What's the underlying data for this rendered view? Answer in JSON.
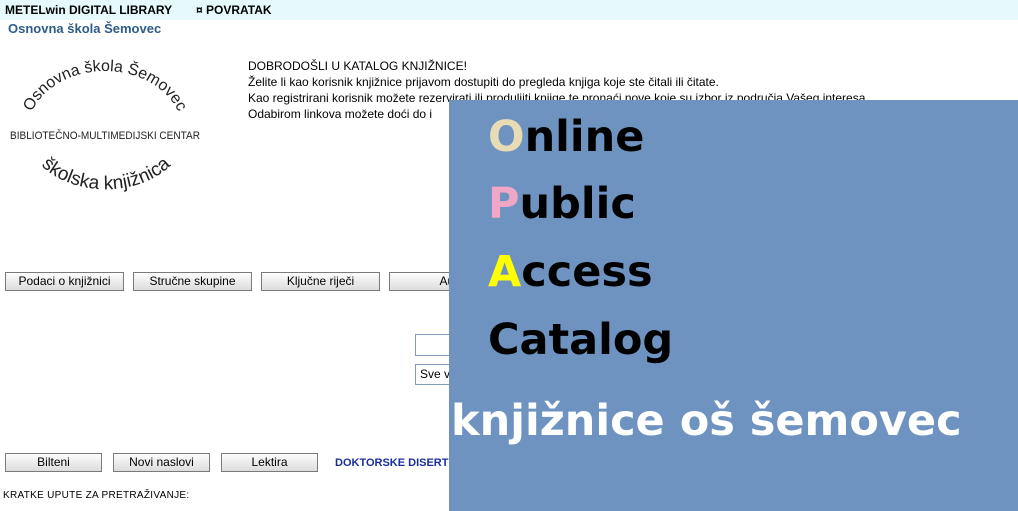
{
  "topbar": {
    "app_title": "METELwin DIGITAL LIBRARY",
    "back_link": "¤ POVRATAK"
  },
  "school_name": "Osnovna škola Šemovec",
  "logo": {
    "text_arc_top": "Osnovna škola Šemovec",
    "text_middle": "BIBLIOTEČNO-MULTIMEDIJSKI CENTAR",
    "text_arc_bottom": "školska knjižnica"
  },
  "welcome": {
    "line1": "DOBRODOŠLI U KATALOG KNJIŽNICE!",
    "line2": "Želite li kao korisnik knjižnice prijavom dostupiti do pregleda knjiga koje ste čitali ili čitate.",
    "line3": "Kao registrirani korisnik možete rezervirati ili produljiti knjige te pronaći nove koje su izbor iz područja Vašeg interesa.",
    "line4": "Odabirom linkova možete doći do i"
  },
  "nav_buttons": {
    "podaci": "Podaci o knjižnici",
    "strucne": "Stručne skupine",
    "kljucne": "Ključne riječi",
    "autori": "Aut"
  },
  "search": {
    "select_value": "Sve v"
  },
  "bottom_buttons": {
    "bilteni": "Bilteni",
    "novi": "Novi naslovi",
    "lektira": "Lektira"
  },
  "doktorske_link": "DOKTORSKE DISERT",
  "tips_label": "KRATKE UPUTE ZA PRETRAŽIVANJE:",
  "overlay": {
    "online_initial": "O",
    "online_rest": "nline",
    "public_initial": "P",
    "public_rest": "ublic",
    "access_initial": "A",
    "access_rest": "ccess",
    "catalog": "Catalog",
    "subtitle": "knjižnice oš šemovec"
  },
  "colors": {
    "topbar_bg": "#e6fafd",
    "school_name": "#2e5b8a",
    "overlay_bg": "#6e93c1",
    "initial_o": "#e7dcb4",
    "initial_p": "#f0a7c6",
    "initial_a": "#ffff00",
    "link": "#1a2f9c"
  }
}
